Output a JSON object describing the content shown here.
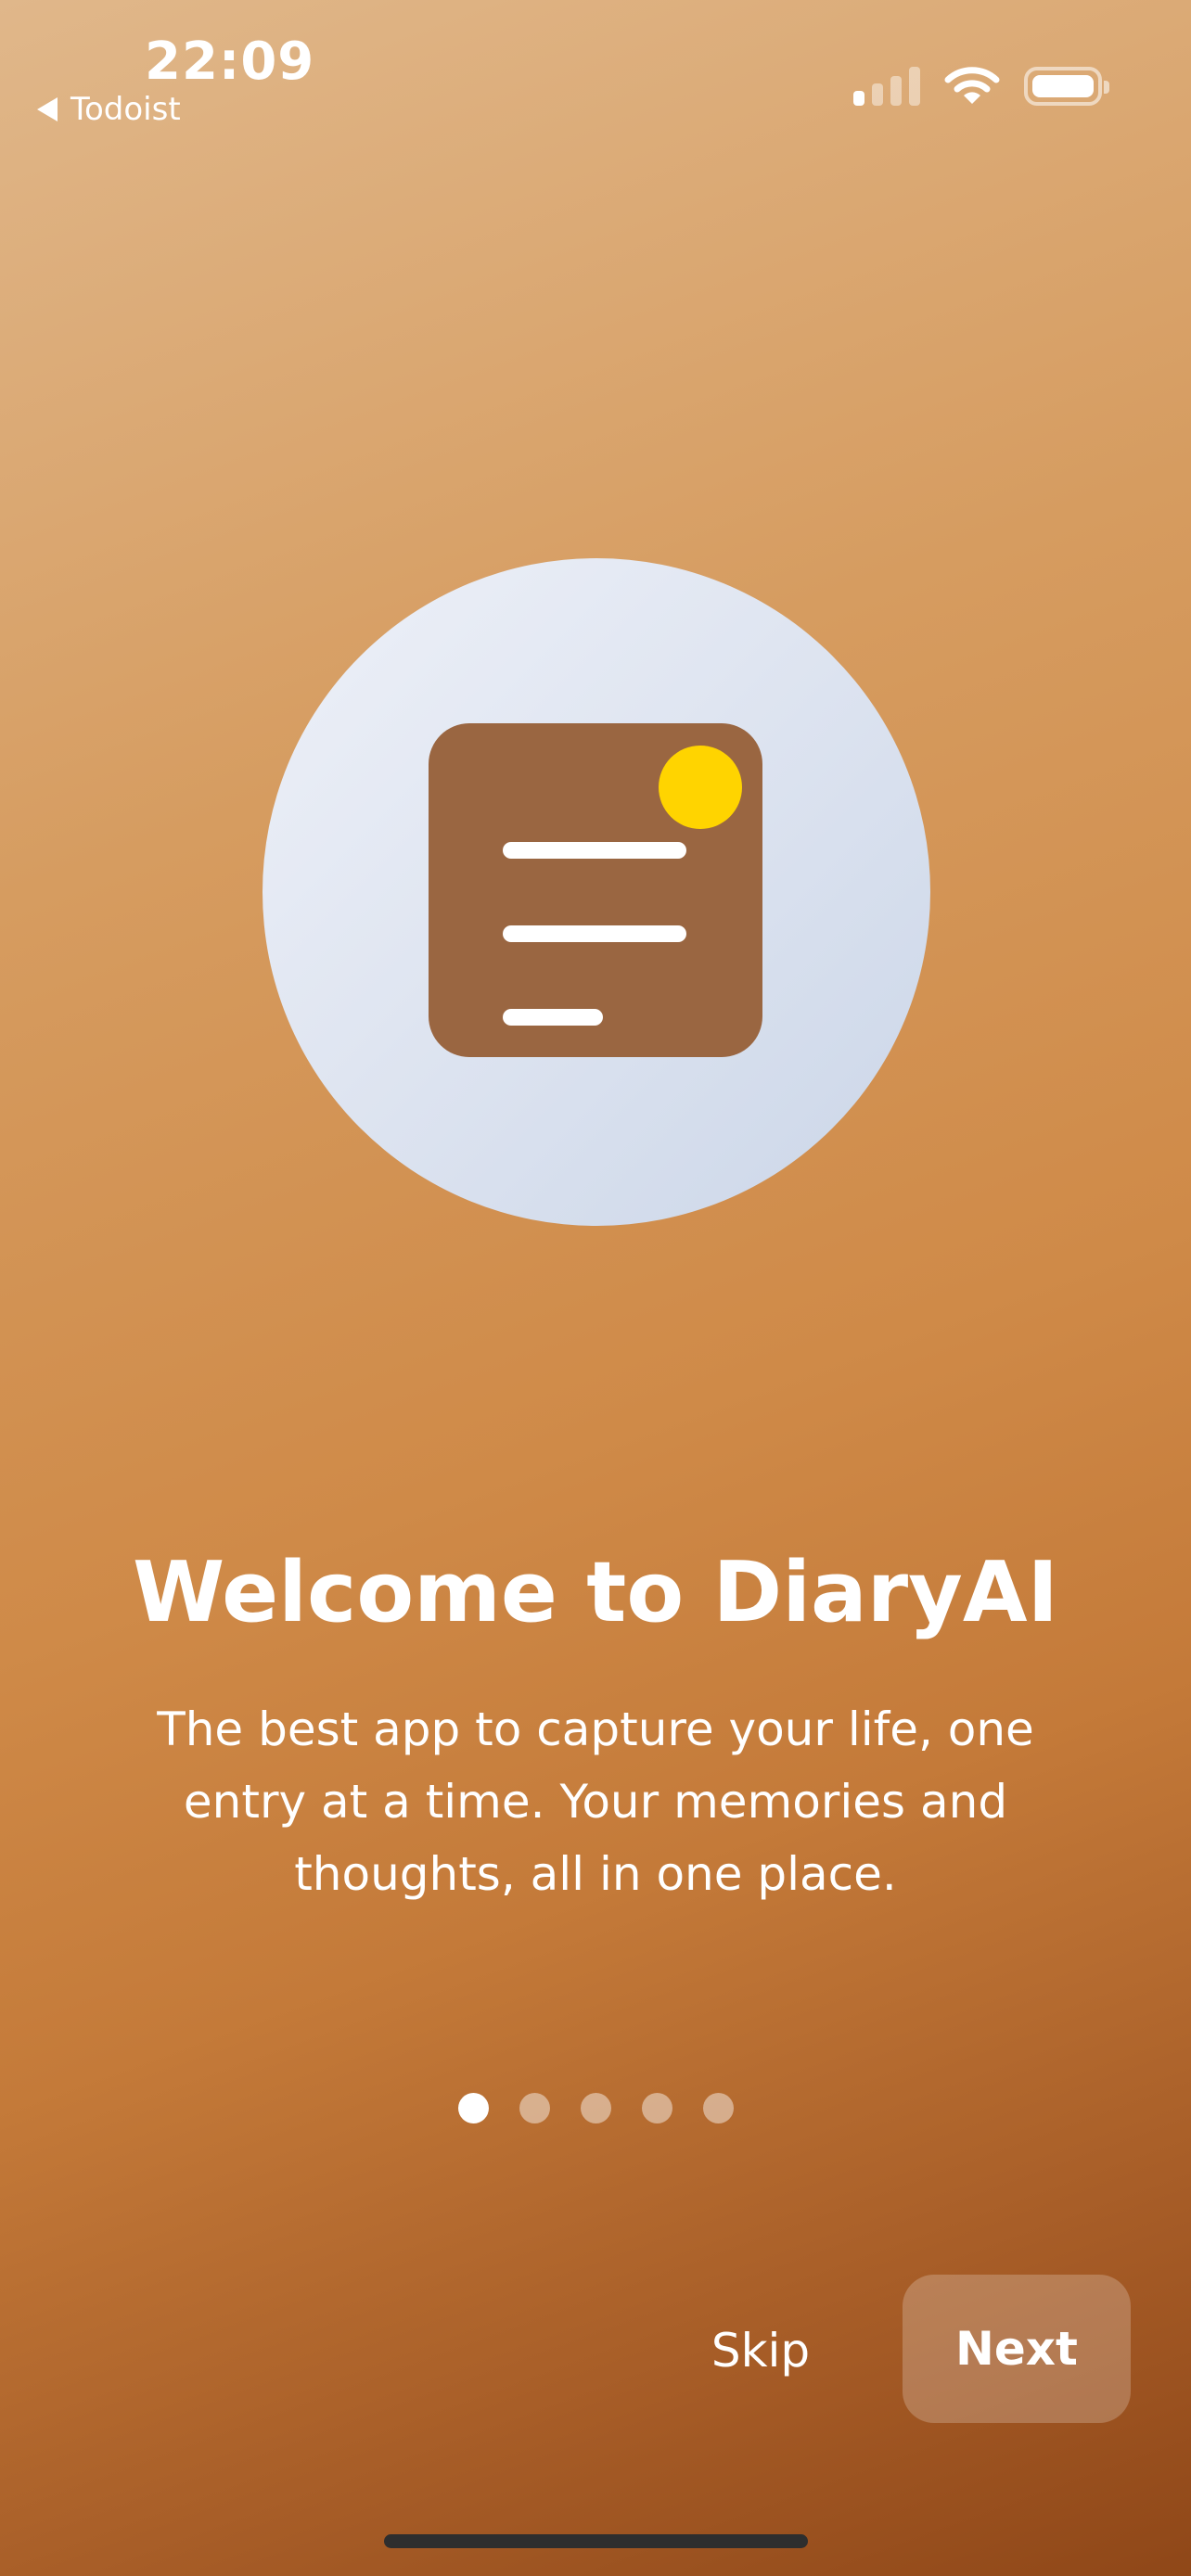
{
  "status_bar": {
    "time": "22:09",
    "back_app": "Todoist",
    "signal_icon": "cellular-signal-icon",
    "wifi_icon": "wifi-icon",
    "battery_icon": "battery-icon",
    "signal_bars_active": 1,
    "signal_bars_total": 4
  },
  "illustration": {
    "icon": "diary-document-icon",
    "colors": {
      "circle": "#dfe5f1",
      "document": "#9a6641",
      "dot": "#ffd400"
    }
  },
  "onboarding": {
    "title": "Welcome to DiaryAI",
    "description": "The best app to capture your life, one entry at a time. Your memories and thoughts, all in one place.",
    "pages_total": 5,
    "current_page": 1
  },
  "actions": {
    "skip_label": "Skip",
    "next_label": "Next"
  }
}
